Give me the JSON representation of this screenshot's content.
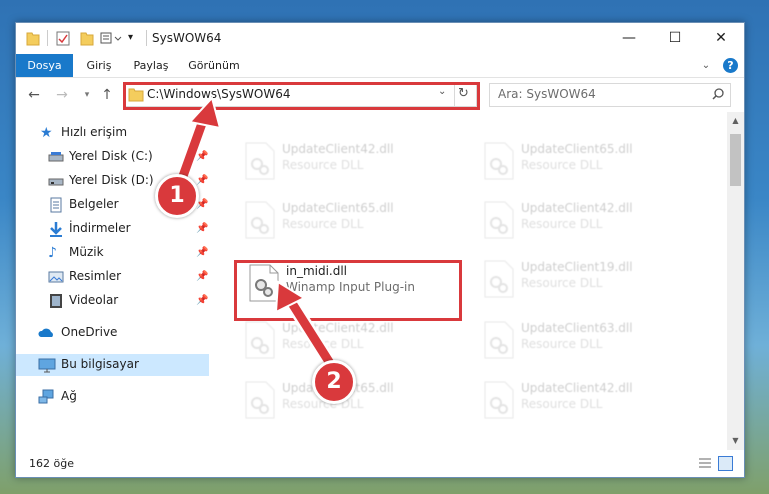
{
  "window": {
    "title": "SysWOW64"
  },
  "window_controls": {
    "minimize": "—",
    "maximize": "☐",
    "close": "✕"
  },
  "ribbon": {
    "tabs": [
      "Dosya",
      "Giriş",
      "Paylaş",
      "Görünüm"
    ]
  },
  "address_bar": {
    "path": "C:\\Windows\\SysWOW64"
  },
  "search": {
    "placeholder": "Ara: SysWOW64"
  },
  "sidebar": {
    "items": [
      {
        "label": "Hızlı erişim",
        "icon": "star-icon"
      },
      {
        "label": "Yerel Disk (C:)",
        "icon": "drive-icon",
        "pinned": true
      },
      {
        "label": "Yerel Disk (D:)",
        "icon": "drive-icon",
        "pinned": true
      },
      {
        "label": "Belgeler",
        "icon": "documents-icon",
        "pinned": true
      },
      {
        "label": "İndirmeler",
        "icon": "download-icon",
        "pinned": true
      },
      {
        "label": "Müzik",
        "icon": "music-icon",
        "pinned": true
      },
      {
        "label": "Resimler",
        "icon": "pictures-icon",
        "pinned": true
      },
      {
        "label": "Videolar",
        "icon": "video-icon",
        "pinned": true
      },
      {
        "label": "OneDrive",
        "icon": "cloud-icon"
      },
      {
        "label": "Bu bilgisayar",
        "icon": "computer-icon",
        "selected": true
      },
      {
        "label": "Ağ",
        "icon": "network-icon"
      }
    ]
  },
  "files": [
    {
      "name": "UpdateClient42.dll",
      "desc": "Resource DLL",
      "faded": true
    },
    {
      "name": "UpdateClient65.dll",
      "desc": "Resource DLL",
      "faded": true
    },
    {
      "name": "UpdateClient65.dll",
      "desc": "Resource DLL",
      "faded": true
    },
    {
      "name": "UpdateClient42.dll",
      "desc": "Resource DLL",
      "faded": true
    },
    {
      "name": "in_midi.dll",
      "desc": "Winamp Input Plug-in",
      "faded": false
    },
    {
      "name": "UpdateClient19.dll",
      "desc": "Resource DLL",
      "faded": true
    },
    {
      "name": "UpdateClient42.dll",
      "desc": "Resource DLL",
      "faded": true
    },
    {
      "name": "UpdateClient63.dll",
      "desc": "Resource DLL",
      "faded": true
    },
    {
      "name": "UpdateClient65.dll",
      "desc": "Resource DLL",
      "faded": true
    },
    {
      "name": "UpdateClient42.dll",
      "desc": "Resource DLL",
      "faded": true
    }
  ],
  "status": {
    "count": "162 öğe"
  },
  "callouts": {
    "one": "1",
    "two": "2"
  },
  "colors": {
    "accent": "#1979ca",
    "highlight": "#d9393c",
    "selected": "#cce8ff"
  }
}
